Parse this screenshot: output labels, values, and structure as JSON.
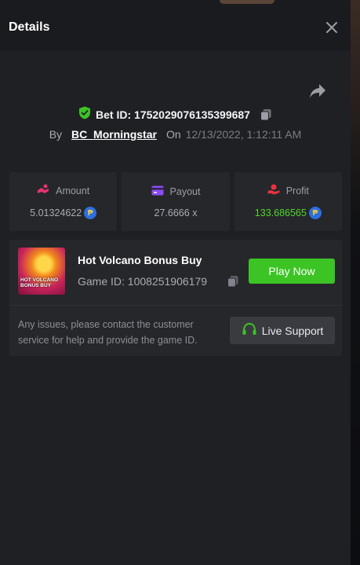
{
  "header": {
    "title": "Details"
  },
  "bet": {
    "label": "Bet ID: 1752029076135399687",
    "by_label": "By",
    "username": "BC_Morningstar",
    "on_label": "On",
    "datetime": "12/13/2022, 1:12:11 AM"
  },
  "stats": [
    {
      "label": "Amount",
      "value": "5.01324622",
      "icon": "amount-icon",
      "coin": true
    },
    {
      "label": "Payout",
      "value": "27.6666 x",
      "icon": "payout-icon",
      "coin": false
    },
    {
      "label": "Profit",
      "value": "133.686565",
      "icon": "profit-icon",
      "coin": true
    }
  ],
  "coin_symbol": "₱",
  "game": {
    "title": "Hot Volcano Bonus Buy",
    "id_label": "Game ID: 1008251906179",
    "thumb_text": "HOT VOLCANO BONUS BUY",
    "play_label": "Play Now"
  },
  "support": {
    "text": "Any issues, please contact the customer service for help and provide the game ID.",
    "button_label": "Live Support"
  },
  "colors": {
    "accent_green": "#3cc425",
    "profit_green": "#4fd52b",
    "coin_blue": "#2d6fe0",
    "amount_pink": "#e8336f",
    "payout_purple": "#8a4df0",
    "profit_red": "#e8333f"
  }
}
